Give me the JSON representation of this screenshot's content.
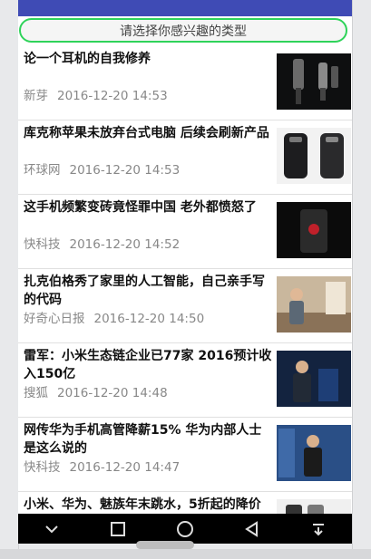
{
  "category_button": {
    "label": "请选择你感兴趣的类型"
  },
  "news": [
    {
      "title": "论一个耳机的自我修养",
      "source": "新芽",
      "time": "2016-12-20 14:53",
      "thumb": "earphone-photo"
    },
    {
      "title": "库克称苹果未放弃台式电脑 后续会刷新产品",
      "source": "环球网",
      "time": "2016-12-20 14:53",
      "thumb": "mac-pro-photo"
    },
    {
      "title": "这手机频繁变砖竟怪罪中国 老外都愤怒了",
      "source": "快科技",
      "time": "2016-12-20 14:52",
      "thumb": "phone-photo"
    },
    {
      "title": "扎克伯格秀了家里的人工智能，自己亲手写的代码",
      "source": "好奇心日报",
      "time": "2016-12-20 14:50",
      "thumb": "zuckerberg-photo"
    },
    {
      "title": "雷军：小米生态链企业已77家 2016预计收入150亿",
      "source": "搜狐",
      "time": "2016-12-20 14:48",
      "thumb": "speaker-photo"
    },
    {
      "title": "网传华为手机高管降薪15% 华为内部人士是这么说的",
      "source": "快科技",
      "time": "2016-12-20 14:47",
      "thumb": "huawei-photo"
    },
    {
      "title": "小米、华为、魅族年末跳水，5折起的降价",
      "source": "",
      "time": "",
      "thumb": "phones-photo"
    }
  ],
  "nav": [
    {
      "icon": "chevron-down-icon",
      "glyph": "⌄"
    },
    {
      "icon": "square-icon",
      "glyph": "□"
    },
    {
      "icon": "circle-icon",
      "glyph": "○"
    },
    {
      "icon": "triangle-back-icon",
      "glyph": "◁"
    },
    {
      "icon": "menu-down-icon",
      "glyph": "⇩"
    }
  ],
  "colors": {
    "statusbar": "#3f4bb5",
    "button_border": "#2fd35a"
  }
}
